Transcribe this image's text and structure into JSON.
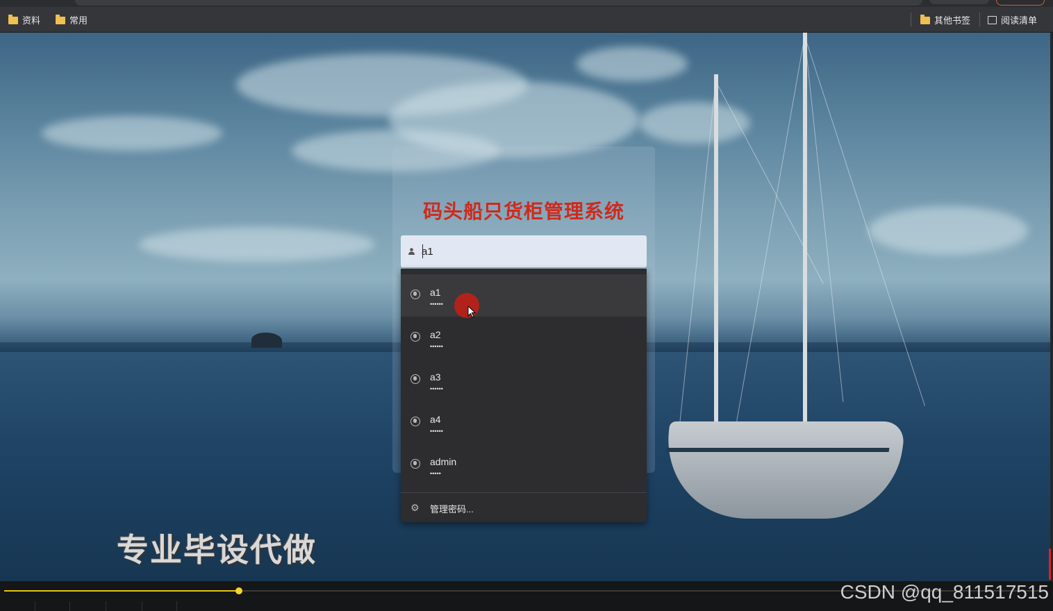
{
  "bookmarks": {
    "left": [
      {
        "label": "资料",
        "icon": "folder-icon"
      },
      {
        "label": "常用",
        "icon": "folder-icon"
      }
    ],
    "other_bookmarks": "其他书签",
    "reading_list": "阅读清单"
  },
  "login": {
    "title": "码头船只货柜管理系统",
    "username_value": "a1"
  },
  "autofill": {
    "items": [
      {
        "username": "a1",
        "password": "••••••"
      },
      {
        "username": "a2",
        "password": "••••••"
      },
      {
        "username": "a3",
        "password": "••••••"
      },
      {
        "username": "a4",
        "password": "••••••"
      },
      {
        "username": "admin",
        "password": "•••••"
      }
    ],
    "manage_label": "管理密码..."
  },
  "overlay": {
    "watermark": "专业毕设代做",
    "credit": "CSDN @qq_811517515"
  },
  "player": {
    "progress": 0.225
  },
  "colors": {
    "title": "#cf2a1b",
    "progress": "#e6c619",
    "dropdown_bg": "#2d2d2f"
  }
}
